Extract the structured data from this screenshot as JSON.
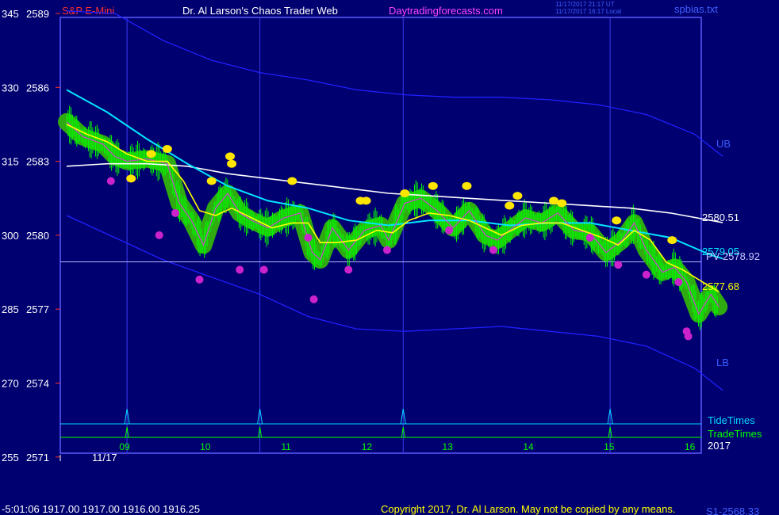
{
  "header": {
    "instrument": "S&P E-Mini",
    "title": "Dr. Al Larson's Chaos Trader Web",
    "site": "Daytradingforecasts.com",
    "ut_time": "11/17/2017 21:17 UT",
    "local_time": "11/17/2017 16:17 Local",
    "file": "spbias.txt"
  },
  "footer": {
    "readout": "-5:01:06  1917.00 1917.00 1916.00 1916.25",
    "copyright": "Copyright 2017, Dr. Al Larson. May not be copied by any means.",
    "s1": "S1-2568.33"
  },
  "colors": {
    "background": "#000070",
    "frame": "#5a5aff",
    "band": "#2020ff",
    "fast_ma": "#ffff00",
    "slow_ma": "#00e5ff",
    "long_ma": "#ffffff",
    "bars": "#00ff00",
    "halo": "#2faa10",
    "high_dot": "#ffe600",
    "low_dot": "#cc22cc",
    "tide": "#00d8ff",
    "trade": "#00ff00"
  },
  "chart_data": {
    "type": "line",
    "xlabel": "",
    "ylabel": "",
    "y_left_labels": [
      "345",
      "330",
      "315",
      "300",
      "285",
      "270",
      "255"
    ],
    "y_right_labels": [
      "2589",
      "2586",
      "2583",
      "2580",
      "2577",
      "2574",
      "2571"
    ],
    "ylim": [
      2571,
      2589
    ],
    "x_ticks": [
      "09",
      "10",
      "11",
      "12",
      "13",
      "14",
      "15",
      "16"
    ],
    "x_date": "11/17",
    "x_year": "2017",
    "legend": [
      "TideTimes",
      "TradeTimes"
    ],
    "annotations": {
      "ub": "UB",
      "lb": "LB",
      "last_price": "2577.68",
      "long_ma_value": "2580.51",
      "slow_ma_value": "2579.05",
      "pv": "PV 2578.92"
    },
    "pv_level": 2578.92,
    "tide_times": [
      8.75,
      10.4,
      12.18,
      14.75
    ],
    "series": [
      {
        "name": "price",
        "x": [
          8.0,
          8.2,
          8.45,
          8.6,
          8.75,
          9.0,
          9.25,
          9.4,
          9.55,
          9.7,
          9.85,
          10.0,
          10.15,
          10.3,
          10.5,
          10.7,
          10.9,
          11.05,
          11.15,
          11.3,
          11.5,
          11.7,
          11.9,
          12.0,
          12.2,
          12.4,
          12.6,
          12.8,
          13.0,
          13.2,
          13.35,
          13.5,
          13.7,
          13.9,
          14.1,
          14.3,
          14.5,
          14.7,
          14.9,
          15.05,
          15.2,
          15.4,
          15.55,
          15.7,
          15.85,
          16.0,
          16.1
        ],
        "values": [
          2584.6,
          2584.0,
          2583.7,
          2583.2,
          2583.0,
          2583.1,
          2582.9,
          2581.3,
          2580.6,
          2579.6,
          2581.1,
          2581.7,
          2580.9,
          2580.6,
          2580.3,
          2580.7,
          2580.9,
          2579.3,
          2579.0,
          2580.3,
          2579.4,
          2580.2,
          2580.4,
          2579.8,
          2581.3,
          2581.5,
          2581.0,
          2580.3,
          2581.0,
          2580.0,
          2579.8,
          2580.2,
          2580.7,
          2580.5,
          2580.9,
          2580.2,
          2580.1,
          2579.3,
          2579.8,
          2580.5,
          2579.4,
          2578.5,
          2578.7,
          2578.1,
          2576.8,
          2577.6,
          2577.1
        ]
      },
      {
        "name": "fast average",
        "x": [
          8.0,
          8.25,
          8.5,
          8.75,
          9.0,
          9.25,
          9.45,
          9.65,
          9.85,
          10.05,
          10.3,
          10.55,
          10.8,
          11.0,
          11.15,
          11.35,
          11.6,
          11.85,
          12.05,
          12.25,
          12.5,
          12.75,
          13.0,
          13.2,
          13.4,
          13.65,
          13.9,
          14.15,
          14.4,
          14.65,
          14.85,
          15.05,
          15.25,
          15.45,
          15.65,
          15.85,
          16.1
        ],
        "values": [
          2584.5,
          2584.1,
          2583.8,
          2583.3,
          2583.0,
          2583.0,
          2582.2,
          2581.0,
          2580.8,
          2581.1,
          2580.7,
          2580.3,
          2580.5,
          2580.5,
          2579.7,
          2579.7,
          2579.8,
          2580.2,
          2580.1,
          2580.6,
          2580.9,
          2580.8,
          2580.6,
          2580.3,
          2580.0,
          2580.4,
          2580.5,
          2580.5,
          2580.2,
          2579.9,
          2579.6,
          2580.2,
          2579.8,
          2578.9,
          2578.6,
          2578.2,
          2577.7
        ]
      },
      {
        "name": "slow average",
        "x": [
          8.0,
          8.5,
          9.0,
          9.5,
          10.0,
          10.5,
          11.0,
          11.5,
          12.0,
          12.5,
          13.0,
          13.5,
          14.0,
          14.5,
          15.0,
          15.5,
          16.0,
          16.15
        ],
        "values": [
          2585.9,
          2585.0,
          2583.9,
          2582.9,
          2582.0,
          2581.4,
          2581.1,
          2580.6,
          2580.4,
          2580.6,
          2580.6,
          2580.4,
          2580.5,
          2580.5,
          2580.2,
          2579.9,
          2579.2,
          2579.05
        ]
      },
      {
        "name": "long average",
        "x": [
          8.0,
          8.5,
          9.0,
          9.5,
          10.0,
          10.5,
          11.0,
          11.5,
          12.0,
          12.5,
          13.0,
          13.5,
          14.0,
          14.5,
          15.0,
          15.5,
          16.0,
          16.15
        ],
        "values": [
          2582.8,
          2582.9,
          2582.9,
          2582.8,
          2582.5,
          2582.3,
          2582.1,
          2581.9,
          2581.7,
          2581.6,
          2581.5,
          2581.4,
          2581.3,
          2581.2,
          2581.1,
          2580.9,
          2580.6,
          2580.51
        ]
      },
      {
        "name": "upper band",
        "x": [
          8.0,
          8.6,
          9.2,
          9.8,
          10.4,
          11.0,
          11.6,
          12.2,
          12.8,
          13.4,
          14.0,
          14.6,
          15.2,
          15.8,
          16.15
        ],
        "values": [
          2589.1,
          2589.0,
          2587.9,
          2587.1,
          2586.6,
          2586.3,
          2585.9,
          2585.7,
          2585.6,
          2585.6,
          2585.5,
          2585.3,
          2584.9,
          2584.1,
          2583.2
        ]
      },
      {
        "name": "lower band",
        "x": [
          8.0,
          8.6,
          9.2,
          9.8,
          10.4,
          11.0,
          11.6,
          12.2,
          12.8,
          13.4,
          14.0,
          14.6,
          15.2,
          15.8,
          16.15
        ],
        "values": [
          2580.8,
          2579.9,
          2579.0,
          2578.3,
          2577.6,
          2576.7,
          2576.2,
          2576.1,
          2576.2,
          2576.3,
          2576.1,
          2575.9,
          2575.5,
          2574.6,
          2573.7
        ]
      }
    ],
    "highs": [
      {
        "x": 8.8,
        "y": 2582.3
      },
      {
        "x": 9.05,
        "y": 2583.3
      },
      {
        "x": 9.25,
        "y": 2583.5
      },
      {
        "x": 9.8,
        "y": 2582.2
      },
      {
        "x": 10.03,
        "y": 2583.2
      },
      {
        "x": 10.05,
        "y": 2582.9
      },
      {
        "x": 10.8,
        "y": 2582.2
      },
      {
        "x": 11.65,
        "y": 2581.4
      },
      {
        "x": 11.72,
        "y": 2581.4
      },
      {
        "x": 12.2,
        "y": 2581.7
      },
      {
        "x": 12.55,
        "y": 2582.0
      },
      {
        "x": 12.97,
        "y": 2582.0
      },
      {
        "x": 13.5,
        "y": 2581.2
      },
      {
        "x": 13.6,
        "y": 2581.6
      },
      {
        "x": 14.05,
        "y": 2581.4
      },
      {
        "x": 14.15,
        "y": 2581.3
      },
      {
        "x": 14.83,
        "y": 2580.6
      },
      {
        "x": 15.52,
        "y": 2579.8
      }
    ],
    "lows": [
      {
        "x": 8.55,
        "y": 2582.2
      },
      {
        "x": 9.15,
        "y": 2580.0
      },
      {
        "x": 9.35,
        "y": 2580.9
      },
      {
        "x": 9.65,
        "y": 2578.2
      },
      {
        "x": 10.15,
        "y": 2578.6
      },
      {
        "x": 10.45,
        "y": 2578.6
      },
      {
        "x": 11.0,
        "y": 2579.9
      },
      {
        "x": 11.07,
        "y": 2577.4
      },
      {
        "x": 11.5,
        "y": 2578.6
      },
      {
        "x": 11.98,
        "y": 2579.4
      },
      {
        "x": 12.75,
        "y": 2580.2
      },
      {
        "x": 13.3,
        "y": 2579.4
      },
      {
        "x": 14.5,
        "y": 2579.9
      },
      {
        "x": 14.85,
        "y": 2578.8
      },
      {
        "x": 15.2,
        "y": 2578.4
      },
      {
        "x": 15.6,
        "y": 2578.1
      },
      {
        "x": 15.7,
        "y": 2576.1
      },
      {
        "x": 15.72,
        "y": 2575.9
      }
    ]
  }
}
